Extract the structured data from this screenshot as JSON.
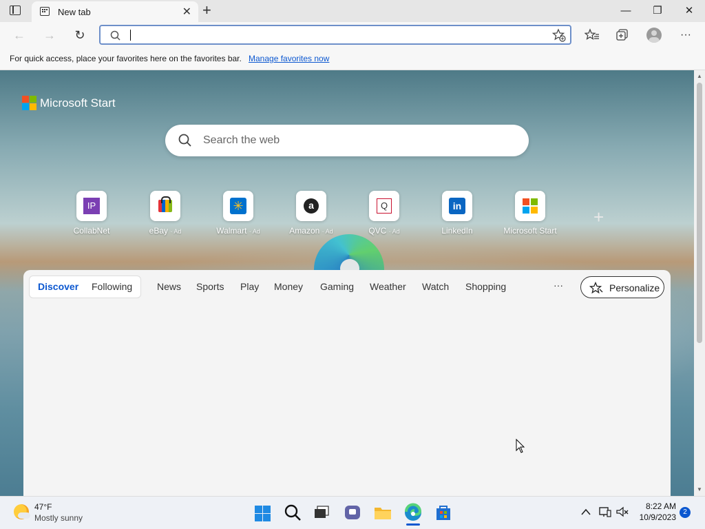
{
  "window": {
    "tab_title": "New tab",
    "tab_close": "✕",
    "new_tab": "+",
    "minimize": "—",
    "maximize": "❐",
    "close": "✕"
  },
  "toolbar": {
    "address_value": "",
    "back_icon": "←",
    "forward_icon": "→",
    "refresh_icon": "↻",
    "more_icon": "···"
  },
  "favbar": {
    "message": "For quick access, place your favorites here on the favorites bar.",
    "link": "Manage favorites now"
  },
  "newtab": {
    "brand": "Microsoft Start",
    "search_placeholder": "Search the web",
    "tiles": [
      {
        "label": "CollabNet",
        "ad": "",
        "glyph": "IP",
        "color": "#7b3fb3"
      },
      {
        "label": "eBay",
        "ad": "· Ad",
        "glyph": "",
        "color": "#e53238"
      },
      {
        "label": "Walmart",
        "ad": "· Ad",
        "glyph": "✳",
        "color": "#0071ce"
      },
      {
        "label": "Amazon",
        "ad": "· Ad",
        "glyph": "a",
        "color": "#222222"
      },
      {
        "label": "QVC",
        "ad": "· Ad",
        "glyph": "Q",
        "color": "#c8102e"
      },
      {
        "label": "LinkedIn",
        "ad": "",
        "glyph": "in",
        "color": "#0a66c2"
      },
      {
        "label": "Microsoft Start",
        "ad": "",
        "glyph": "",
        "color": "#f25022"
      }
    ],
    "add_tile": "+"
  },
  "feed": {
    "tabs": [
      "Discover",
      "Following",
      "News",
      "Sports",
      "Play",
      "Money",
      "Gaming",
      "Weather",
      "Watch",
      "Shopping"
    ],
    "more": "···",
    "personalize": "Personalize",
    "accent": "#0b57d0"
  },
  "taskbar": {
    "temperature": "47°F",
    "condition": "Mostly sunny",
    "time": "8:22 AM",
    "date": "10/9/2023",
    "notifications": "2"
  }
}
